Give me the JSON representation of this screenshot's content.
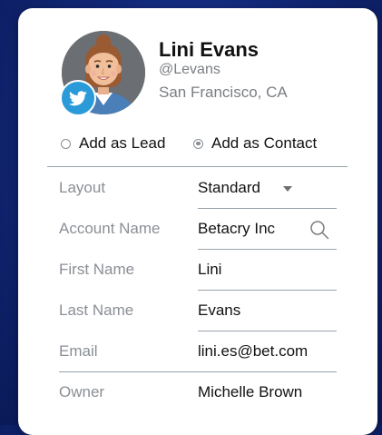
{
  "contact": {
    "name": "Lini Evans",
    "handle": "@Levans",
    "location": "San Francisco, CA",
    "social_icon": "twitter-bird-icon"
  },
  "options": {
    "lead_label": "Add as Lead",
    "contact_label": "Add as Contact",
    "selected": "contact"
  },
  "fields": {
    "layout": {
      "label": "Layout",
      "value": "Standard"
    },
    "account_name": {
      "label": "Account Name",
      "value": "Betacry Inc"
    },
    "first_name": {
      "label": "First Name",
      "value": "Lini"
    },
    "last_name": {
      "label": "Last Name",
      "value": "Evans"
    },
    "email": {
      "label": "Email",
      "value": "lini.es@bet.com"
    },
    "owner": {
      "label": "Owner",
      "value": "Michelle Brown"
    }
  },
  "colors": {
    "background": "#13287a",
    "card": "#ffffff",
    "twitter": "#2a9bd8",
    "divider": "#9aa3ab",
    "label_text": "#8a8f95",
    "value_text": "#111111"
  }
}
